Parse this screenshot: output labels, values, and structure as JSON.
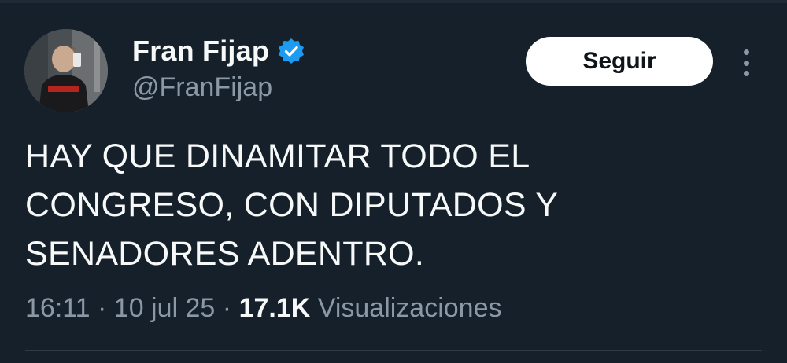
{
  "author": {
    "display_name": "Fran Fijap",
    "handle": "@FranFijap",
    "verified": true,
    "verified_icon": "verified-badge-icon",
    "verified_color": "#1d9bf0"
  },
  "actions": {
    "follow_label": "Seguir",
    "more_icon": "more-vertical-icon"
  },
  "tweet": {
    "lines": [
      "HAY QUE DINAMITAR TODO EL",
      "CONGRESO, CON DIPUTADOS Y",
      "SENADORES ADENTRO."
    ]
  },
  "meta": {
    "time": "16:11",
    "separator": "·",
    "date": "10 jul 25",
    "views_count": "17.1K",
    "views_label": "Visualizaciones"
  },
  "colors": {
    "background": "#15202b",
    "text_primary": "#f7f9f9",
    "text_secondary": "#8b98a5",
    "button_bg": "#ffffff",
    "button_text": "#0f1419"
  }
}
